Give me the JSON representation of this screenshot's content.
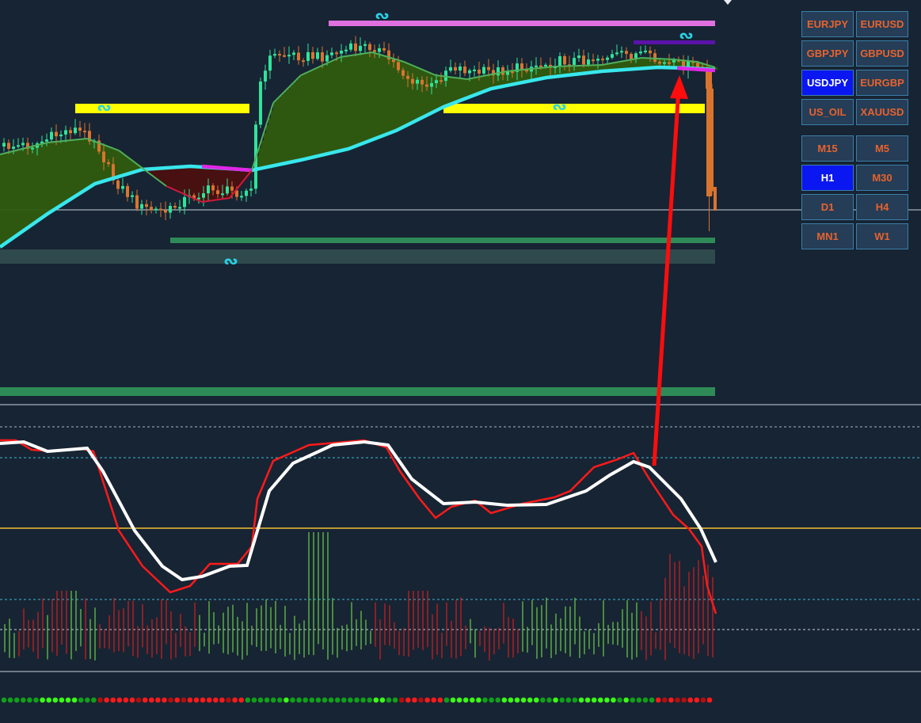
{
  "symbols": [
    {
      "label": "EURJPY",
      "active": false
    },
    {
      "label": "EURUSD",
      "active": false
    },
    {
      "label": "GBPJPY",
      "active": false
    },
    {
      "label": "GBPUSD",
      "active": false
    },
    {
      "label": "USDJPY",
      "active": true
    },
    {
      "label": "EURGBP",
      "active": false
    },
    {
      "label": "US_OIL",
      "active": false
    },
    {
      "label": "XAUUSD",
      "active": false
    }
  ],
  "timeframes": [
    {
      "label": "M15",
      "active": false
    },
    {
      "label": "M5",
      "active": false
    },
    {
      "label": "H1",
      "active": true
    },
    {
      "label": "M30",
      "active": false
    },
    {
      "label": "D1",
      "active": false
    },
    {
      "label": "H4",
      "active": false
    },
    {
      "label": "MN1",
      "active": false
    },
    {
      "label": "W1",
      "active": false
    }
  ],
  "zone_labels": {
    "magenta_zone": "ᔓ",
    "purple_zone": "ᔓ",
    "yellow_zone_left": "ᔓ",
    "yellow_zone_right": "ᔓ",
    "support_zone": "ᔓ"
  },
  "colors": {
    "background": "#172433",
    "bull_candle": "#2ee59a",
    "bear_candle": "#d9742f",
    "fast_ma": "#d11a3a",
    "slow_ma": "#38e7ec",
    "yellow_zone": "#ffff00",
    "magenta_zone": "#e070e0",
    "purple_zone": "#5a12a8",
    "support_zone": "#2e8b57",
    "oscillator_fast": "#ff1a1a",
    "oscillator_slow": "#ffffff",
    "osc_level": "#f2c230",
    "histogram_up": "#6bcf4a",
    "histogram_down": "#d31f1f",
    "arrow": "#ff0d0d",
    "panel_button": "#253d56",
    "panel_button_active": "#0a17f0",
    "panel_text": "#e8622e"
  }
}
